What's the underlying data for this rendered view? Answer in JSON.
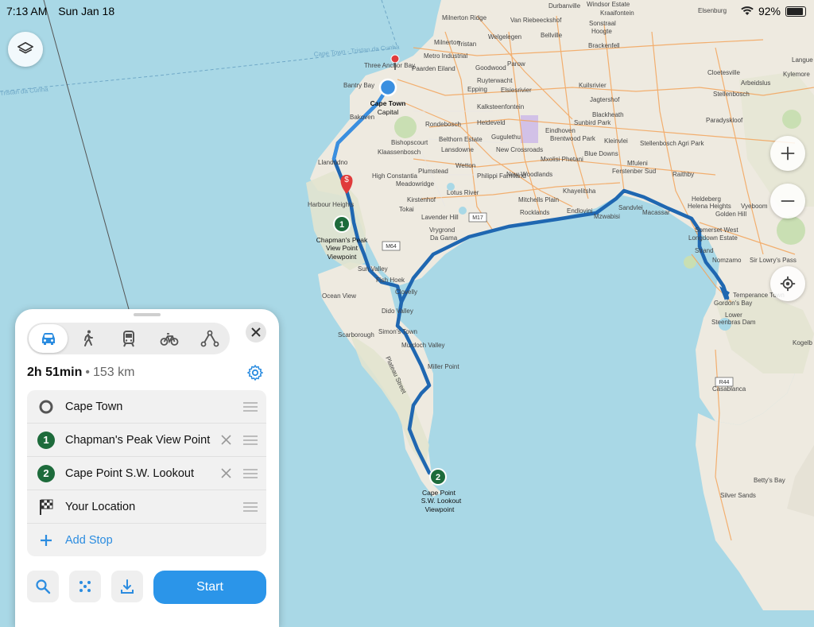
{
  "status_bar": {
    "time": "7:13 AM",
    "date": "Sun Jan 18",
    "battery": "92%"
  },
  "map": {
    "labels": {
      "durbanville": "Durbanville",
      "windsor": "Windsor Estate",
      "kraaifontein": "Kraaifontein",
      "elsenburg": "Elsenburg",
      "milnerton_ridge": "Milnerton Ridge",
      "van_riebeeck": "Van Riebeeckshof",
      "sonstraal": "Sonstraal",
      "hoogte": "Hoogte",
      "bellville": "Bellville",
      "brackenfell": "Brackenfell",
      "milnerton": "Milnerton",
      "welgelegen": "Welgelegen",
      "tristan": "Tristan",
      "cape_town_line": "Cape Town - Tristan da Cunha",
      "tristan_line": "Tristan da Cunha",
      "langue": "Langue",
      "kylemore": "Kylemore",
      "three_anchor": "Three Anchor Bay",
      "metro": "Metro Industrial",
      "paarden": "Paarden Eiland",
      "parow": "Parow",
      "goodwood": "Goodwood",
      "ruyterwacht": "Ruyterwacht",
      "kuilsrivier": "Kuilsrivier",
      "elsiesrivier": "Elsiesrivier",
      "cloetesville": "Cloetesville",
      "arbeidslus": "Arbeidslus",
      "stellenbosch": "Stellenbosch",
      "bantry": "Bantry Bay",
      "cape_town": "Cape Town",
      "capital": "Capital",
      "epping": "Epping",
      "jagtershof": "Jagtershof",
      "kalksteenfontein": "Kalksteenfontein",
      "paradyskloof": "Paradyskloof",
      "bakoven": "Bakoven",
      "rondebosch": "Rondebosch",
      "heideveld": "Heideveld",
      "sunbird": "Sunbird Park",
      "eindhoven": "Eindhoven",
      "brentwood": "Brentwood Park",
      "blackheath": "Blackheath",
      "kleinvlei": "Kleinvlei",
      "stellenbosch_agri": "Stellenbosch Agri Park",
      "bishopscourt": "Bishopscourt",
      "belthorn": "Belthorn Estate",
      "gugulethu": "Gugulethu",
      "new_crossroads": "New Crossroads",
      "blue_downs": "Blue Downs",
      "klaassenbosch": "Klaassenbosch",
      "lansdowne": "Lansdowne",
      "mfuleni": "Mfuleni",
      "llandudno": "Llandudno",
      "constantia": "High Constantia",
      "wetton": "Wetton",
      "philippi": "Philippi Farmland",
      "new_woodlands": "New Woodlands",
      "mxolisi": "Mxolisi Phetani",
      "faerster": "Ferstenber Sud",
      "raithby": "Raithby",
      "plumstead": "Plumstead",
      "meadowridge": "Meadowridge",
      "lotus": "Lotus River",
      "khayelitsha": "Khayelitsha",
      "hout_bay": "Harbour Heights",
      "tokai": "Tokai",
      "kirstenhof": "Kirstenhof",
      "mitchells": "Mitchells Plain",
      "sandvlei": "Sandvlei",
      "macassar": "Macassar",
      "heldeberg": "Heldeberg",
      "helena": "Helena Heights",
      "golden_hill": "Golden Hill",
      "vyeboom": "Vyeboom",
      "rocklands": "Rocklands",
      "endlovini": "Endlovini",
      "mzwabisi": "Mzwabisi",
      "m17": "M17",
      "m64": "M64",
      "r44": "R44",
      "somerset": "Somerset West",
      "longdown": "Longdown Estate",
      "chapmans": "Chapman's Peak",
      "view_point": "View Point",
      "viewpoint": "Viewpoint",
      "lavender": "Lavender Hill",
      "vrygrond": "Vrygrond",
      "da_gama": "Da Gama",
      "strand": "Strand",
      "nomzamo": "Nomzamo",
      "sir_lowry": "Sir Lowry's Pass",
      "sun_valley": "Sun Valley",
      "fish_hoek": "Fish Hoek",
      "clovelly": "Clovelly",
      "ocean_view": "Ocean View",
      "dido": "Dido Valley",
      "gordons": "Gordon's Bay",
      "temperance": "Temperance Town",
      "lower": "Lower",
      "steenbras": "Steenbras Dam",
      "simons": "Simon's Town",
      "scarborough": "Scarborough",
      "murdoch": "Murdoch Valley",
      "kogelb": "Kogelb",
      "plateau": "Plateau Street",
      "miller": "Miller Point",
      "cape_point": "Cape Point",
      "sw_lookout": "S.W. Lookout",
      "cape_point_vp": "Viewpoint",
      "bettys": "Betty's Bay",
      "silver_sands": "Silver Sands",
      "caselanca": "Casablanca"
    },
    "pin1": "1",
    "pin2": "2",
    "colors": {
      "water": "#a9d8e6",
      "land": "#eeeae0",
      "route": "#1f67b1",
      "route_start": "#3a8fe0",
      "stop_pin": "#1d6b3b"
    }
  },
  "map_controls": {
    "layers_icon": "layers-icon",
    "zoom_in_icon": "plus-icon",
    "zoom_out_icon": "minus-icon",
    "locate_icon": "location-target-icon"
  },
  "panel": {
    "modes": [
      "car",
      "walk",
      "transit",
      "bike",
      "route"
    ],
    "summary": {
      "duration": "2h 51min",
      "separator": "•",
      "distance": "153 km"
    },
    "stops": [
      {
        "label": "Cape Town",
        "marker": "origin"
      },
      {
        "label": "Chapman's Peak View Point",
        "marker": "1"
      },
      {
        "label": "Cape Point S.W. Lookout",
        "marker": "2"
      },
      {
        "label": "Your Location",
        "marker": "finish"
      }
    ],
    "add_stop": "Add Stop",
    "start": "Start"
  }
}
